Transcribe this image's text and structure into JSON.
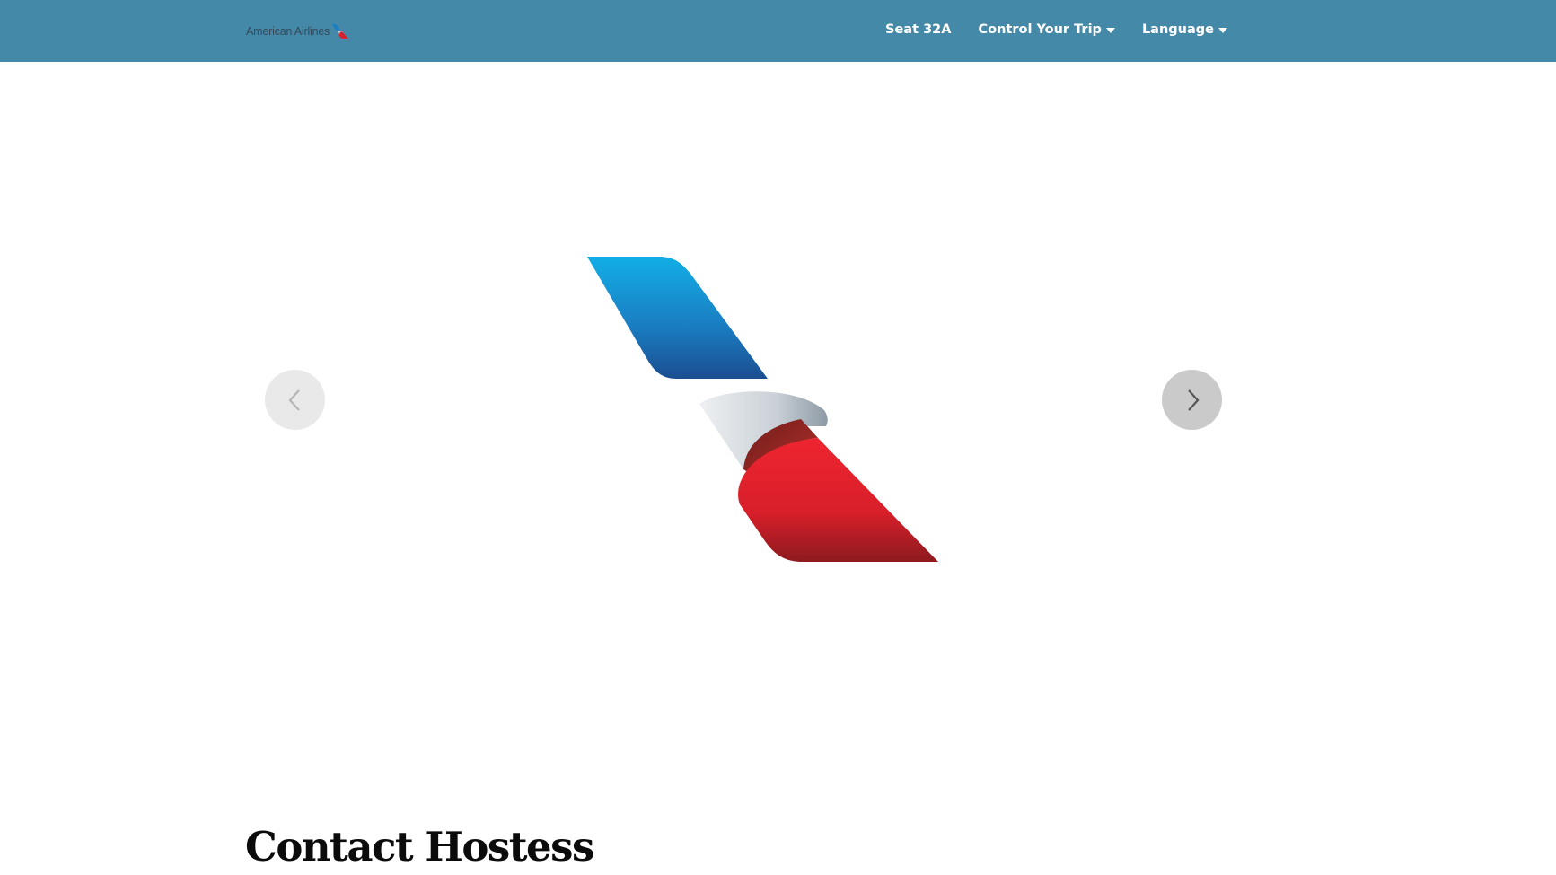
{
  "navbar": {
    "brand_text": "American Airlines",
    "brand_icon": "flight-symbol-logo",
    "items": [
      {
        "label": "Seat 32A",
        "has_dropdown": false
      },
      {
        "label": "Control Your Trip",
        "has_dropdown": true
      },
      {
        "label": "Language",
        "has_dropdown": true
      }
    ],
    "background_color": "#4589a8"
  },
  "carousel": {
    "slide_image": "american-airlines-flight-symbol",
    "prev_icon": "chevron-left-icon",
    "next_icon": "chevron-right-icon"
  },
  "main": {
    "heading": "Contact Hostess"
  },
  "colors": {
    "accent_blue": "#0ea5e0",
    "accent_red": "#e3232d",
    "silver": "#c9d0d6"
  }
}
